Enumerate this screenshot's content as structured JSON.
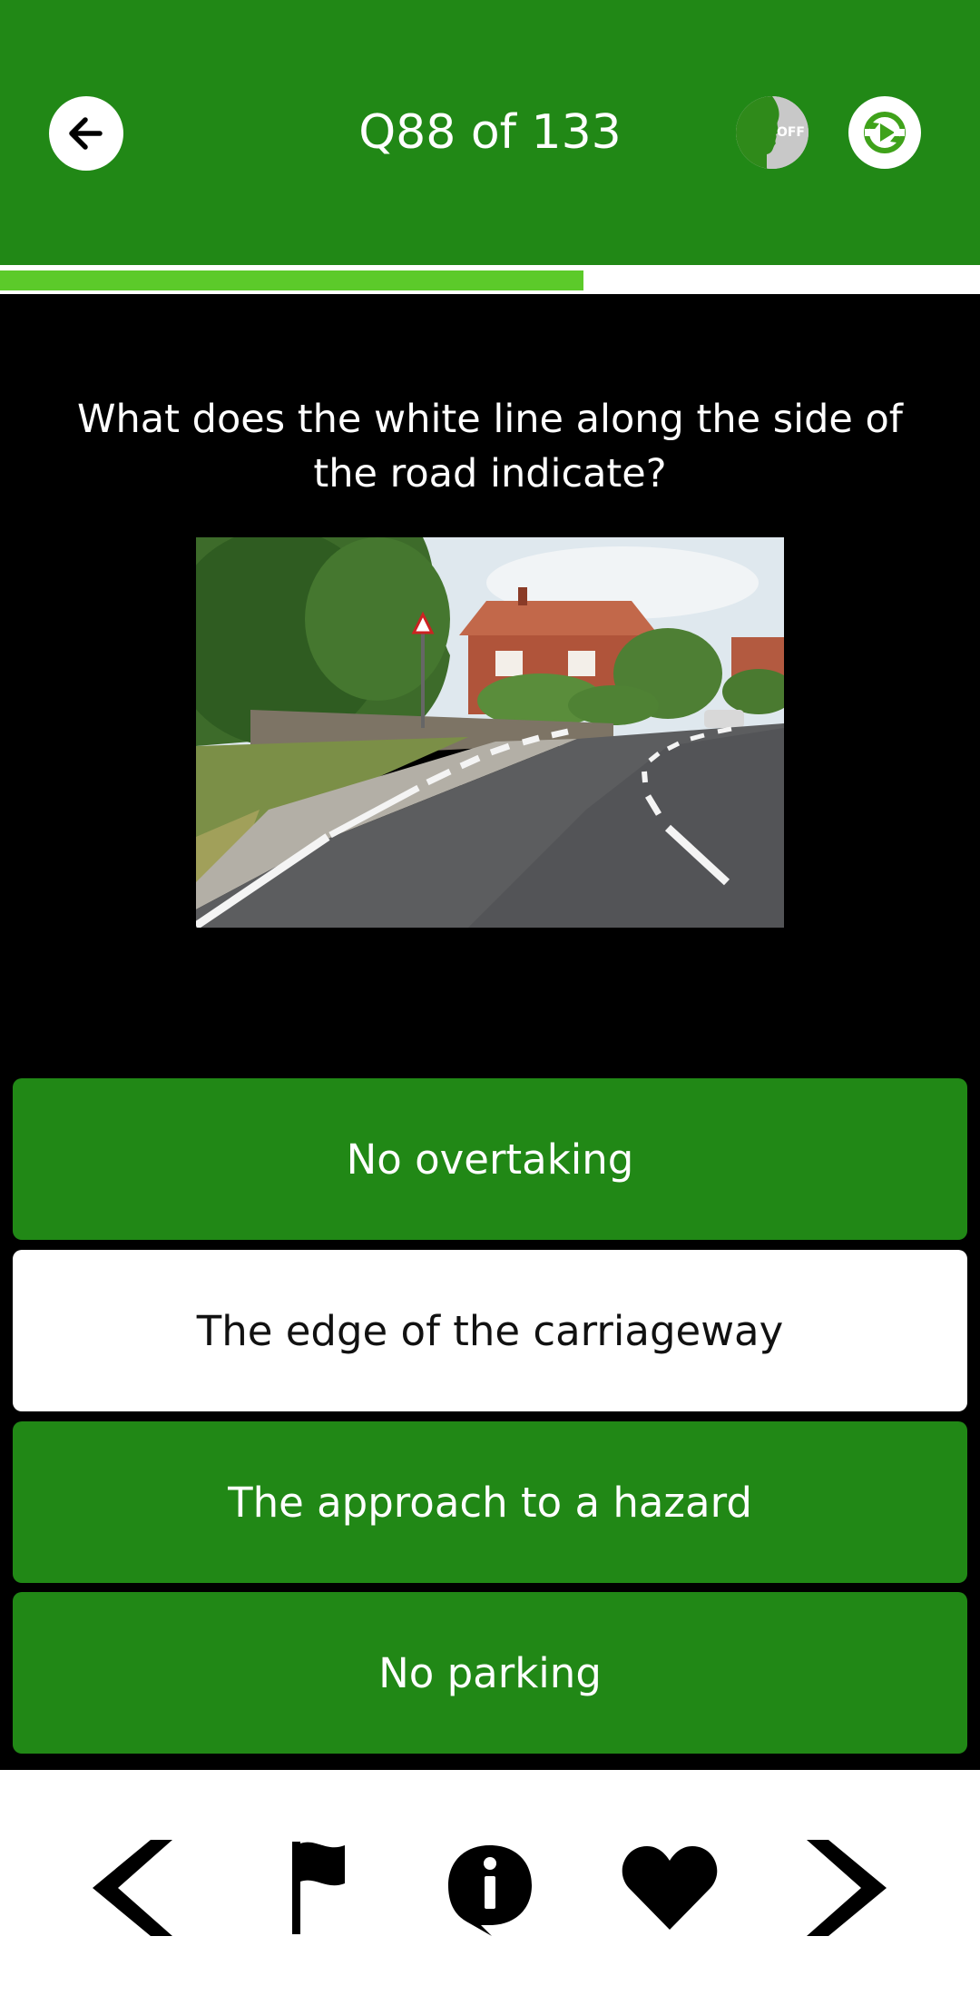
{
  "header": {
    "title": "Q88 of 133",
    "voice_toggle_state": "OFF",
    "back_icon": "arrow-left-icon",
    "refresh_icon": "refresh-play-icon",
    "color": "#218816"
  },
  "progress": {
    "current": 88,
    "total": 133,
    "fraction": 0.6617,
    "fill_color": "#5cca2a"
  },
  "question": {
    "text": "What does the white line along the side of the road indicate?"
  },
  "answers": [
    {
      "label": "No overtaking",
      "selected": false
    },
    {
      "label": "The edge of the carriageway",
      "selected": true
    },
    {
      "label": "The approach to a hazard",
      "selected": false
    },
    {
      "label": "No parking",
      "selected": false
    }
  ],
  "bottom_nav": [
    {
      "icon": "chevron-left-icon"
    },
    {
      "icon": "flag-icon"
    },
    {
      "icon": "info-icon"
    },
    {
      "icon": "heart-icon"
    },
    {
      "icon": "chevron-right-icon"
    }
  ]
}
